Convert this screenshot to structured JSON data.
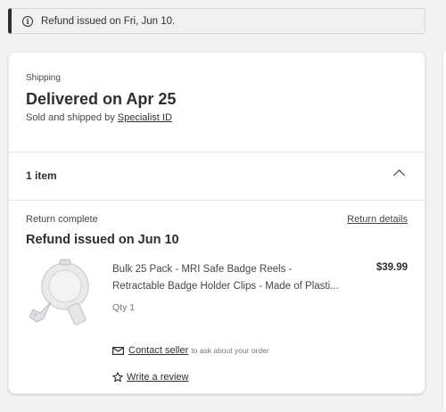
{
  "banner": {
    "text": "Refund issued on Fri, Jun 10.",
    "icon": "info-icon"
  },
  "shipping": {
    "label": "Shipping",
    "delivered": "Delivered on Apr 25",
    "sold_by_prefix": "Sold and shipped by",
    "seller": "Specialist ID"
  },
  "items": {
    "count_label": "1 item",
    "toggle_icon": "chevron-up-icon"
  },
  "return": {
    "status": "Return complete",
    "details_link": "Return details",
    "refund_title": "Refund issued on Jun 10"
  },
  "product": {
    "name_line1": "Bulk 25 Pack - MRI Safe Badge Reels -",
    "name_line2": "Retractable Badge Holder Clips - Made of Plasti...",
    "price": "$39.99",
    "qty": "Qty 1",
    "image": "badge-reel-image"
  },
  "actions": {
    "contact_link": "Contact seller",
    "contact_hint": "to ask about your order",
    "review_link": "Write a review"
  }
}
